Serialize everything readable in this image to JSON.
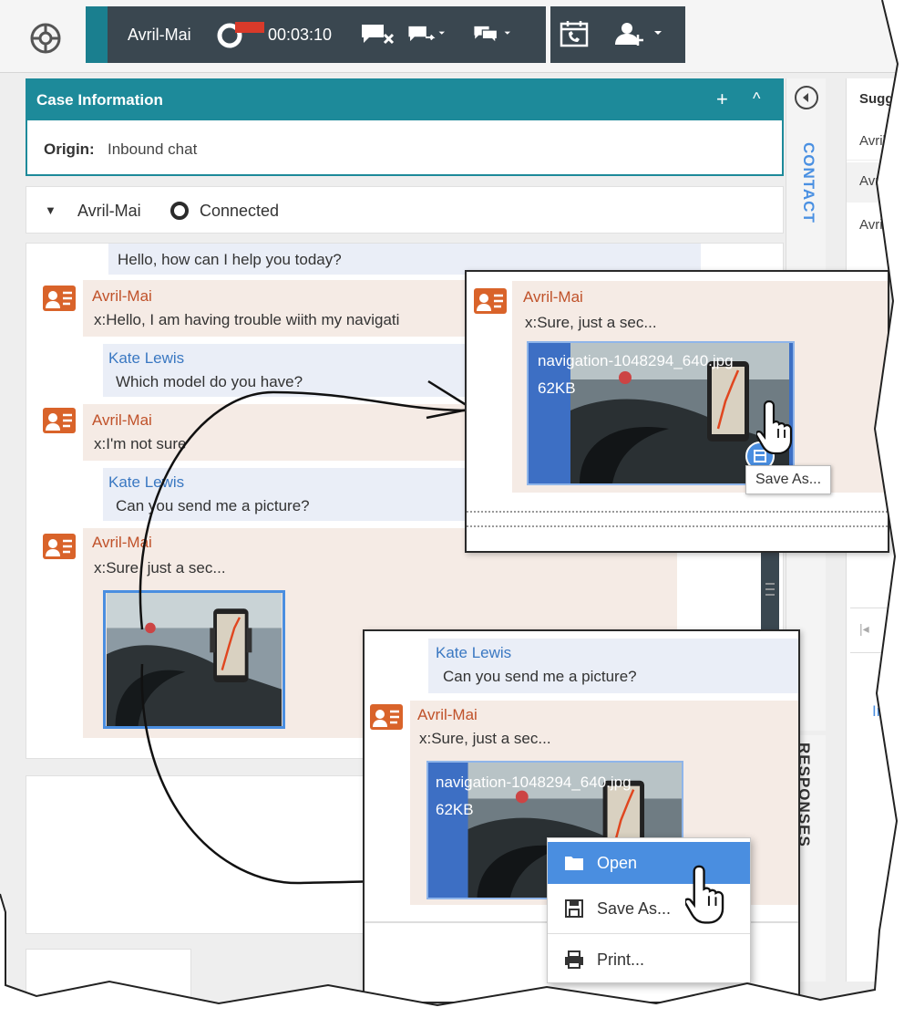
{
  "toolbar": {
    "contact_name": "Avril-Mai",
    "timer": "00:03:10"
  },
  "case_info": {
    "title": "Case Information",
    "add_label": "+",
    "collapse_label": "^",
    "origin_label": "Origin:",
    "origin_value": "Inbound chat"
  },
  "side_tabs": {
    "contact": "CONTACT",
    "responses": "RESPONSES"
  },
  "suggestions": {
    "header": "Sugge",
    "items": [
      "Avril M",
      "Avril M",
      "Avril",
      "Inf"
    ]
  },
  "interaction": {
    "party": "Avril-Mai",
    "status": "Connected"
  },
  "transcript": {
    "messages": [
      {
        "sender": "",
        "text": "Hello, how can I help you today?"
      },
      {
        "sender": "Avril-Mai",
        "text": "x:Hello, I am having trouble wiith my navigati"
      },
      {
        "sender": "Kate Lewis",
        "text": "Which model do you have?"
      },
      {
        "sender": "Avril-Mai",
        "text": "x:I'm not sure"
      },
      {
        "sender": "Kate Lewis",
        "text": "Can you send me a picture?"
      },
      {
        "sender": "Avril-Mai",
        "text": "x:Sure, just a sec..."
      }
    ]
  },
  "callout1": {
    "sender": "Avril-Mai",
    "text": "x:Sure, just a sec...",
    "file_name": "navigation-1048294_640.jpg",
    "file_size": "62KB",
    "tooltip": "Save As..."
  },
  "callout2": {
    "agent_sender": "Kate Lewis",
    "agent_text": "Can you send me a picture?",
    "sender": "Avril-Mai",
    "text": "x:Sure, just a sec...",
    "file_name": "navigation-1048294_640.jpg",
    "file_size": "62KB"
  },
  "context_menu": {
    "items": [
      "Open",
      "Save As...",
      "Print..."
    ]
  },
  "colors": {
    "teal": "#1d8a9a",
    "dark": "#3a4750",
    "customer": "#c0522a",
    "agent": "#3a78c2",
    "menu_highlight": "#4a8ee0"
  }
}
